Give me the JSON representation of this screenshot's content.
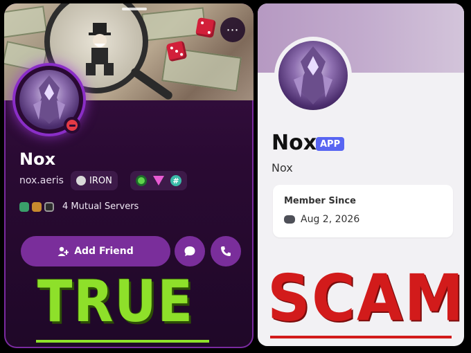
{
  "left_card": {
    "name": "Nox",
    "username": "nox.aeris",
    "clan_tag": "IRON",
    "badges": [
      "green-ring-badge",
      "pink-gem-badge",
      "hashtag-badge"
    ],
    "badge_hashtag": "#",
    "mutual_servers": "4 Mutual Servers",
    "add_friend": "Add Friend",
    "more_icon": "⋯",
    "status": "do-not-disturb",
    "accent_color": "#7a2e9b"
  },
  "right_card": {
    "name": "Nox",
    "app_tag": "APP",
    "username": "Nox",
    "member_since_title": "Member Since",
    "member_since_date": "Aug 2, 2026",
    "accent_color": "#5865f2"
  },
  "verdicts": {
    "left": "TRUE",
    "right": "SCAM",
    "left_color": "#8ee02a",
    "right_color": "#d21b1b"
  }
}
